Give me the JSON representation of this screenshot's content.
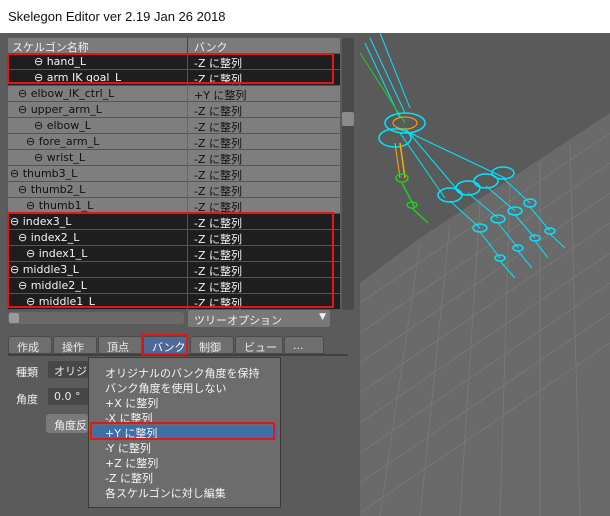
{
  "window": {
    "title": "Skelegon Editor ver 2.19 Jan 26 2018"
  },
  "list": {
    "col_name": "スケルゴン名称",
    "col_bank": "バンク",
    "rows": [
      {
        "label": "⊖ hand_L",
        "bank": "-Z に整列",
        "selected": true
      },
      {
        "label": "⊖ arm IK goal_L",
        "bank": "-Z に整列",
        "selected": true
      },
      {
        "label": "⊖ elbow_IK_ctrl_L",
        "bank": "+Y に整列",
        "selected": false
      },
      {
        "label": "⊖ upper_arm_L",
        "bank": "-Z に整列",
        "selected": false
      },
      {
        "label": "⊖ elbow_L",
        "bank": "-Z に整列",
        "selected": false
      },
      {
        "label": "⊖ fore_arm_L",
        "bank": "-Z に整列",
        "selected": false
      },
      {
        "label": "⊖ wrist_L",
        "bank": "-Z に整列",
        "selected": false
      },
      {
        "label": "⊖ thumb3_L",
        "bank": "-Z に整列",
        "selected": false
      },
      {
        "label": "⊖ thumb2_L",
        "bank": "-Z に整列",
        "selected": false
      },
      {
        "label": "⊖ thumb1_L",
        "bank": "-Z に整列",
        "selected": false
      },
      {
        "label": "⊖ index3_L",
        "bank": "-Z に整列",
        "selected": true
      },
      {
        "label": "⊖ index2_L",
        "bank": "-Z に整列",
        "selected": true
      },
      {
        "label": "⊖ index1_L",
        "bank": "-Z に整列",
        "selected": true
      },
      {
        "label": "⊖ middle3_L",
        "bank": "-Z に整列",
        "selected": true
      },
      {
        "label": "⊖ middle2_L",
        "bank": "-Z に整列",
        "selected": true
      },
      {
        "label": "⊖ middle1_L",
        "bank": "-Z に整列",
        "selected": true
      }
    ]
  },
  "tree_option": {
    "label": "ツリーオプション"
  },
  "tabs": [
    "作成",
    "操作",
    "頂点",
    "バンク",
    "制御",
    "ビュー",
    "..."
  ],
  "active_tab": "バンク",
  "form": {
    "type_label": "種類",
    "type_value": "オリジ",
    "angle_label": "角度",
    "angle_value": "0.0 °",
    "angle_button": "角度反"
  },
  "menu": {
    "items": [
      "オリジナルのバンク角度を保持",
      "バンク角度を使用しない",
      "+X に整列",
      "-X に整列",
      "+Y に整列",
      "-Y に整列",
      "+Z に整列",
      "-Z に整列",
      "各スケルゴンに対し編集"
    ],
    "highlighted": "+Y に整列"
  },
  "colors": {
    "highlight_box": "#e01818",
    "menu_highlight": "#3e6fa8",
    "bone_cyan": "#00e5ff",
    "bone_green": "#22cc22",
    "bone_orange": "#ffaa00"
  }
}
